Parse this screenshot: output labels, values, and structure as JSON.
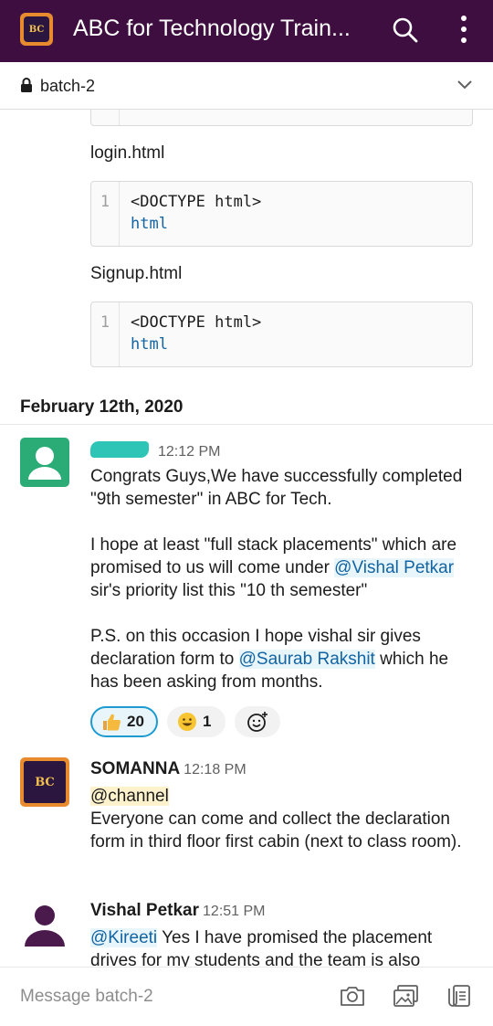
{
  "header": {
    "workspace_title": "ABC for Technology Train...",
    "logo_text": "BC"
  },
  "channel": {
    "name": "batch-2"
  },
  "code_blocks": [
    {
      "file_label": "login.html",
      "line_number": "1",
      "line1": "<DOCTYPE html>",
      "line2": "html"
    },
    {
      "file_label": "Signup.html",
      "line_number": "1",
      "line1": "<DOCTYPE html>",
      "line2": "html"
    }
  ],
  "date_divider": "February 12th, 2020",
  "messages": [
    {
      "time": "12:12 PM",
      "p1": "Congrats Guys,We have successfully completed \"9th semester\" in ABC for Tech.",
      "p2_a": "I hope at least \"full stack placements\" which are promised to us will come under ",
      "p2_mention": "@Vishal Petkar",
      "p2_b": "  sir's priority list this \"10 th semester\"",
      "p3_a": "P.S.  on this occasion I hope vishal sir gives declaration form to ",
      "p3_mention": "@Saurab Rakshit",
      "p3_b": " which he has been asking from months.",
      "reactions": [
        {
          "emoji": "thumbs-up",
          "count": "20",
          "active": true
        },
        {
          "emoji": "grinning-face",
          "count": "1",
          "active": false
        }
      ]
    },
    {
      "author": "SOMANNA",
      "time": "12:18 PM",
      "channel_mention": "@channel",
      "text": "Everyone can come and collect the declaration form in third floor first cabin (next to class room)."
    },
    {
      "author": "Vishal Petkar",
      "time": "12:51 PM",
      "mention": "@Kireeti",
      "text": " Yes I have promised the placement drives for my students and the team is also"
    }
  ],
  "composer": {
    "placeholder": "Message batch-2"
  },
  "colors": {
    "appbar": "#3f0e40",
    "mention": "#1264a3",
    "reaction_active_border": "#1d9bd1"
  }
}
